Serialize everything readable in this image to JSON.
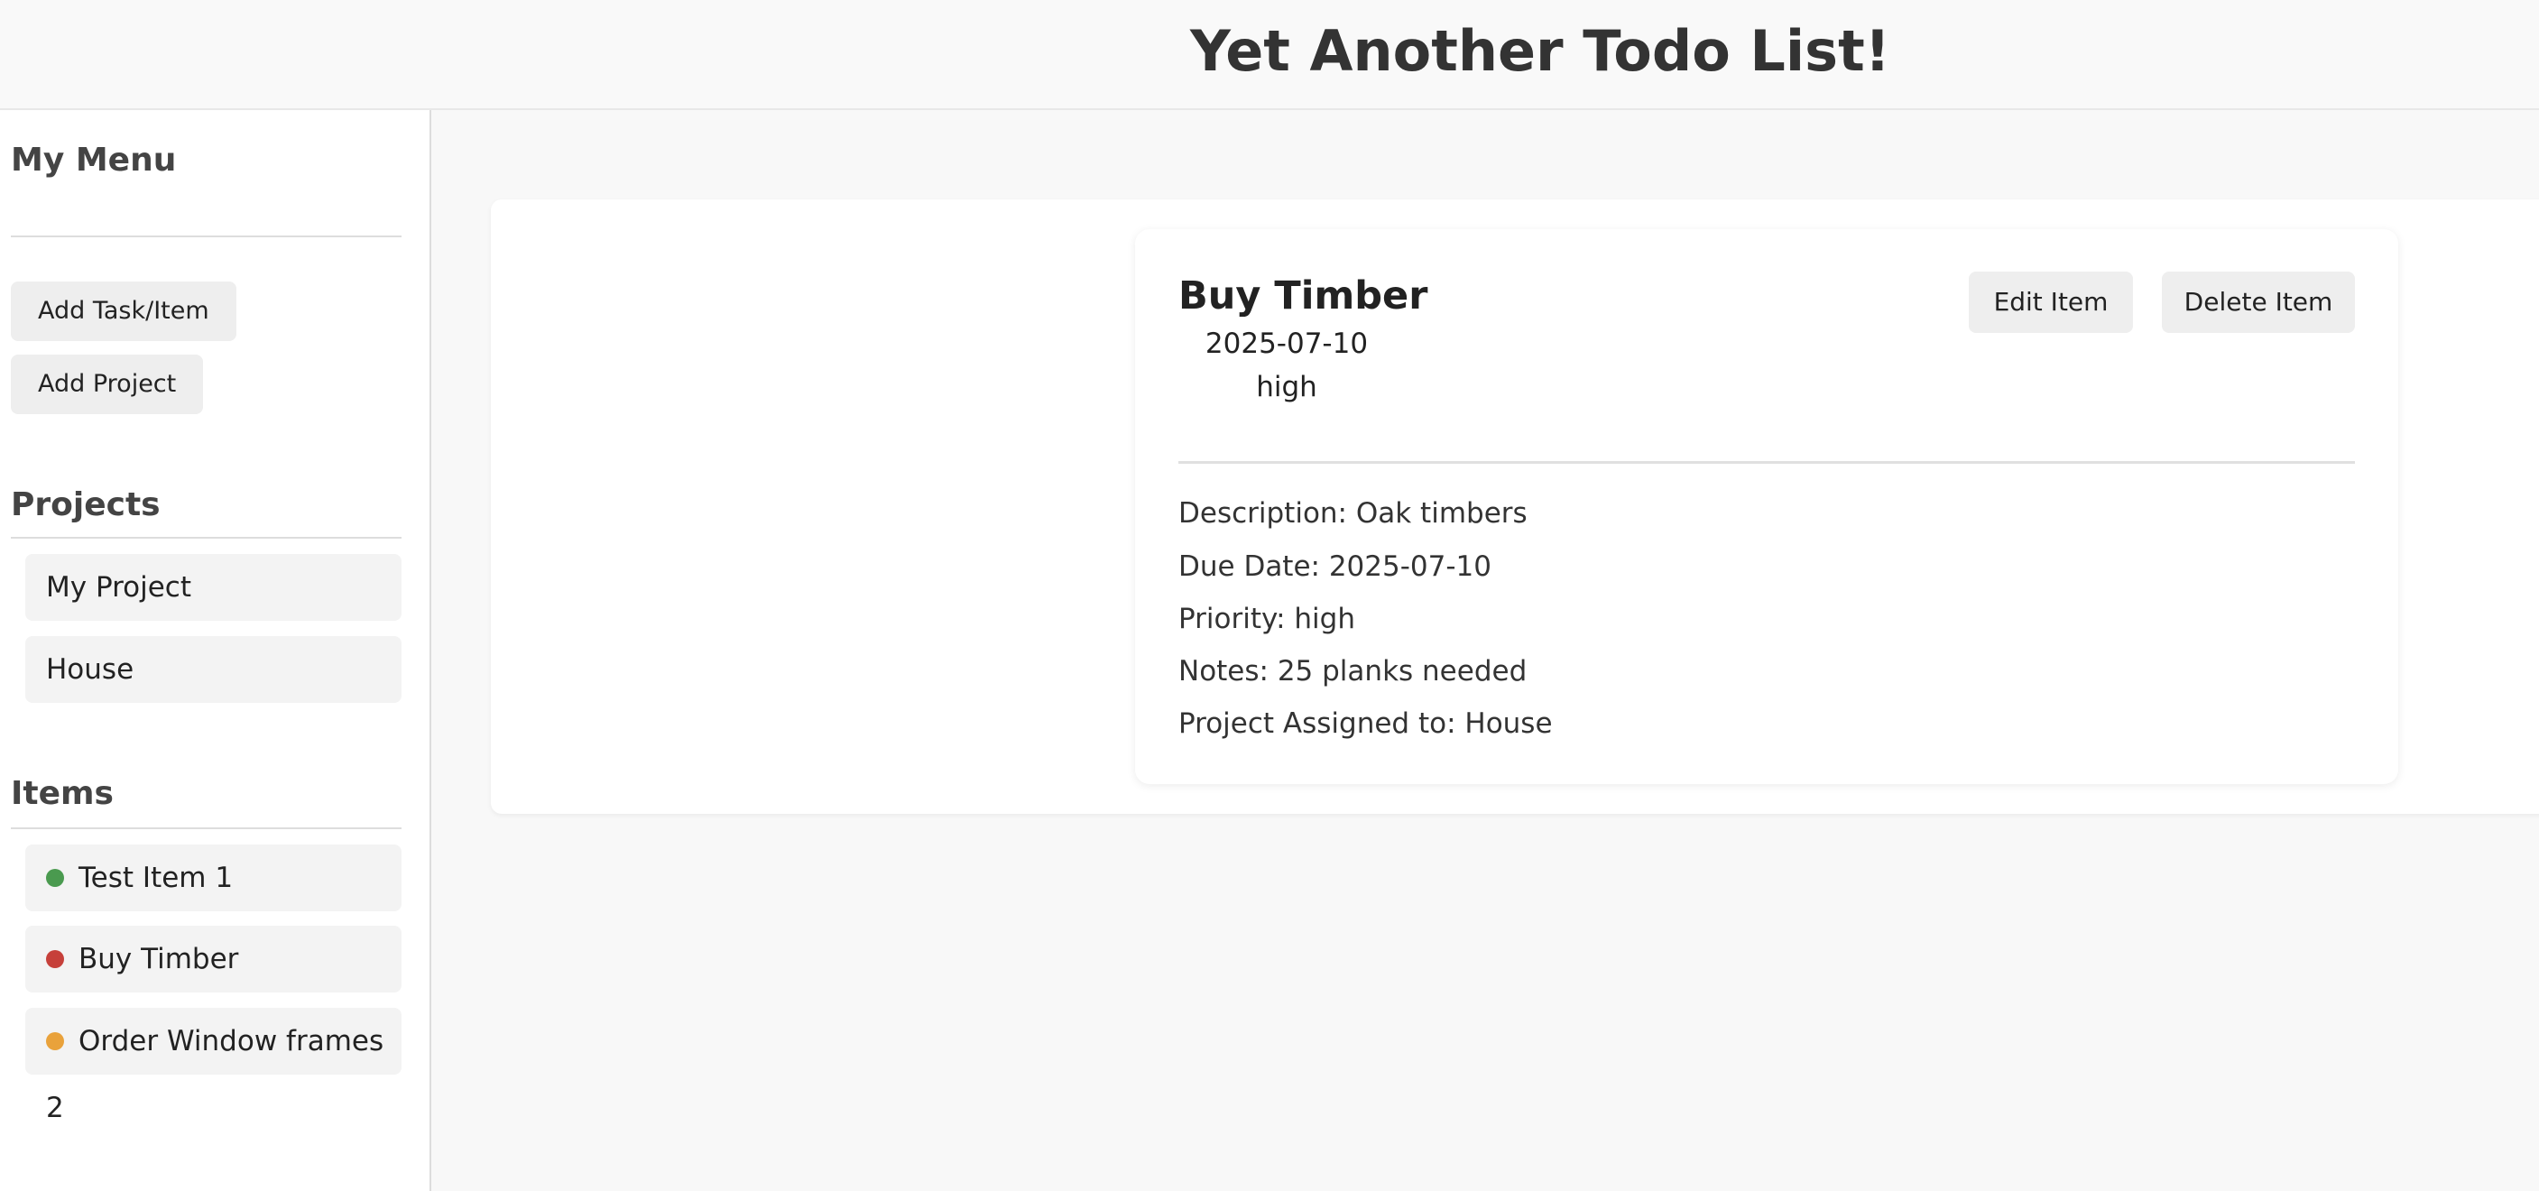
{
  "header": {
    "title": "Yet Another Todo List!"
  },
  "sidebar": {
    "menu_heading": "My Menu",
    "add_task_label": "Add Task/Item",
    "add_project_label": "Add Project",
    "projects_heading": "Projects",
    "projects": [
      {
        "label": "My Project"
      },
      {
        "label": "House"
      }
    ],
    "items_heading": "Items",
    "items": [
      {
        "label": "Test Item 1",
        "priority_color": "#4a9a4f"
      },
      {
        "label": "Buy Timber",
        "priority_color": "#c6403a"
      },
      {
        "label": "Order Window frames 2",
        "priority_color": "#e9a23b"
      }
    ]
  },
  "detail": {
    "title": "Buy Timber",
    "date": "2025-07-10",
    "priority": "high",
    "edit_label": "Edit Item",
    "delete_label": "Delete Item",
    "description": "Description: Oak timbers",
    "due_date": "Due Date: 2025-07-10",
    "priority_line": "Priority: high",
    "notes": "Notes: 25 planks needed",
    "project": "Project Assigned to: House"
  }
}
